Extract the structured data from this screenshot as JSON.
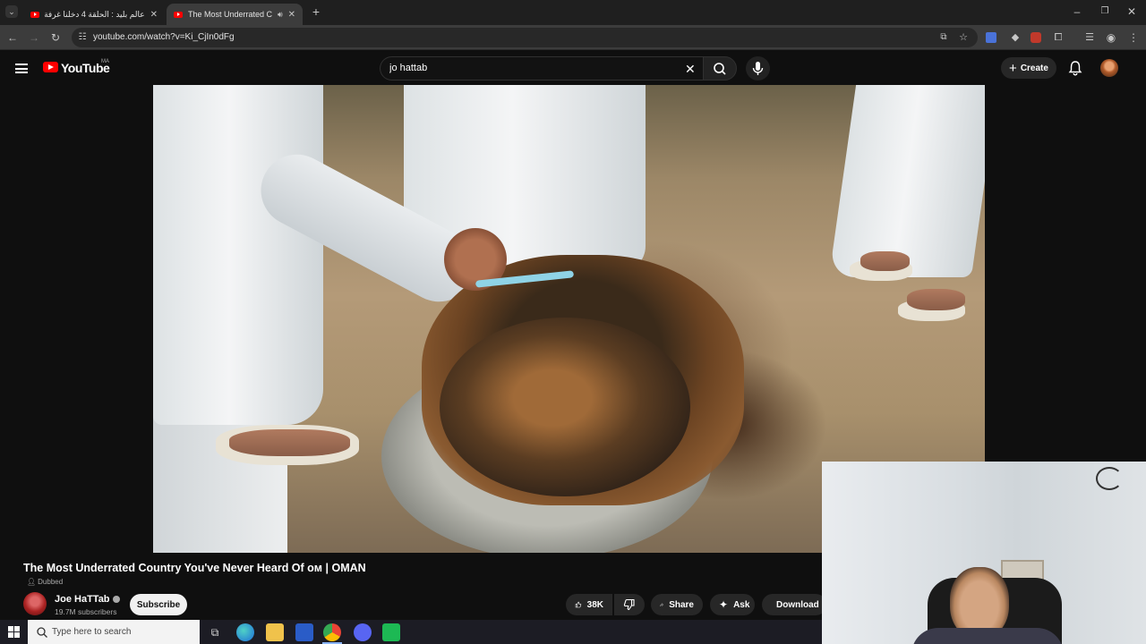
{
  "browser": {
    "tabs": [
      {
        "title": "عالم بليد : الحلقة 4 دخلنا غرفة 😳",
        "active": false
      },
      {
        "title": "The Most Underrated Coun",
        "active": true
      }
    ],
    "url": "youtube.com/watch?v=Ki_CjIn0dFg"
  },
  "youtube": {
    "logo_text": "YouTube",
    "country_code": "MA",
    "search_value": "jo hattab",
    "create_label": "Create"
  },
  "video": {
    "title": "The Most Underrated Country You've Never Heard Of ᴏᴍ | OMAN",
    "dubbed_label": "Dubbed",
    "channel_name": "Joe HaTTab",
    "subscribers": "19.7M subscribers",
    "subscribe_label": "Subscribe",
    "likes": "38K",
    "share_label": "Share",
    "ask_label": "Ask",
    "download_label": "Download"
  },
  "taskbar": {
    "search_placeholder": "Type here to search"
  },
  "colors": {
    "youtube_red": "#ff0000",
    "page_bg": "#0f0f0f",
    "pill_bg": "#272727"
  }
}
